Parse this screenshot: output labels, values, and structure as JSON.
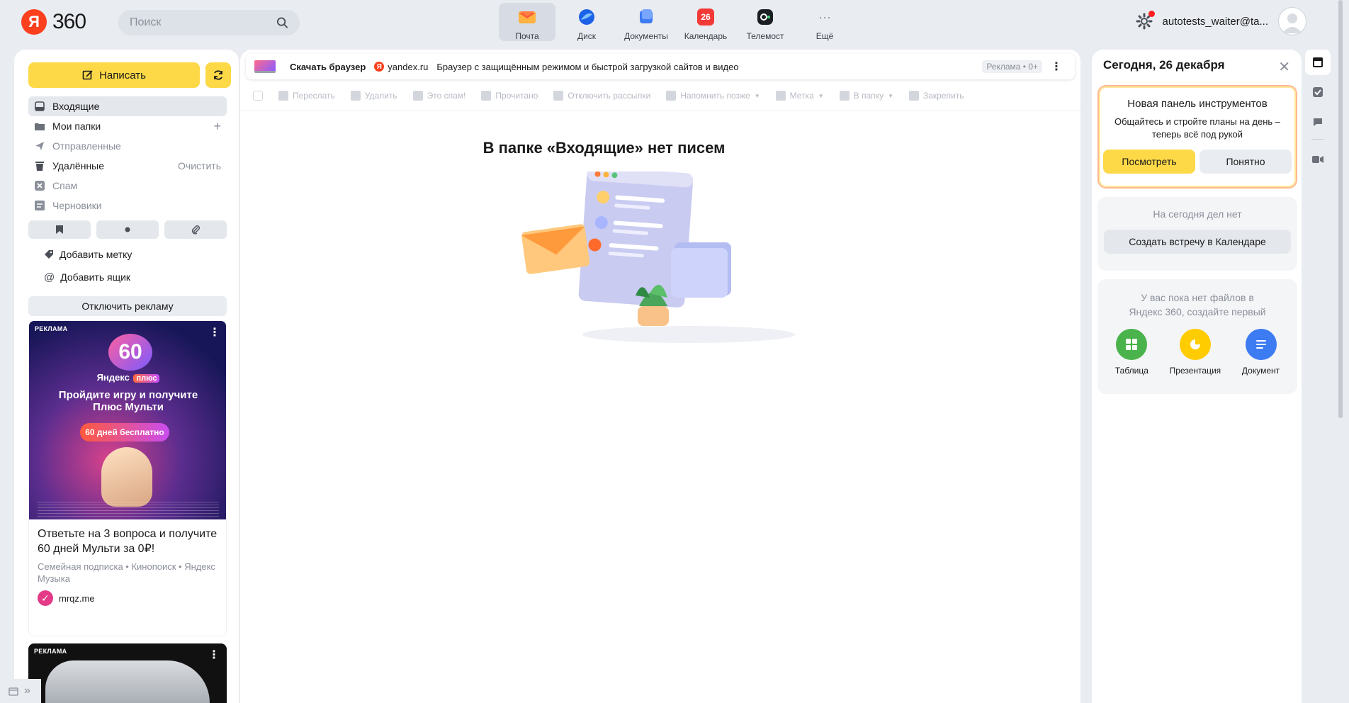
{
  "header": {
    "logo_letter": "Я",
    "logo_suffix": "360",
    "search_placeholder": "Поиск",
    "services": [
      {
        "label": "Почта",
        "icon": "mail-icon",
        "active": true
      },
      {
        "label": "Диск",
        "icon": "disk-icon"
      },
      {
        "label": "Документы",
        "icon": "documents-icon"
      },
      {
        "label": "Календарь",
        "icon": "calendar-icon",
        "badge": "26"
      },
      {
        "label": "Телемост",
        "icon": "telemost-icon"
      },
      {
        "label": "Ещё",
        "icon": "more-icon"
      }
    ],
    "user_email": "autotests_waiter@ta...",
    "colors": {
      "accent": "#fdd947",
      "brand_red": "#fc3f1d",
      "notification": "#ff1e1e"
    }
  },
  "sidebar": {
    "compose_label": "Написать",
    "folders": [
      {
        "label": "Входящие",
        "icon": "inbox-icon",
        "active": true
      },
      {
        "label": "Мои папки",
        "icon": "folder-icon",
        "action": "+"
      },
      {
        "label": "Отправленные",
        "icon": "sent-icon",
        "dim": true
      },
      {
        "label": "Удалённые",
        "icon": "trash-icon",
        "action": "Очистить"
      },
      {
        "label": "Спам",
        "icon": "spam-icon",
        "dim": true
      },
      {
        "label": "Черновики",
        "icon": "drafts-icon",
        "dim": true
      }
    ],
    "add_label": "Добавить метку",
    "add_mailbox": "Добавить ящик",
    "disable_ads": "Отключить рекламу",
    "ad1": {
      "badge": "РЕКЛАМА",
      "number": "60",
      "brand": "Яндекс",
      "brand_plus": "плюс",
      "headline": "Пройдите игру и получите Плюс Мульти",
      "pill": "60 дней бесплатно",
      "title": "Ответьте на 3 вопроса и получите 60 дней Мульти за 0₽!",
      "subtitle": "Семейная подписка • Кинопоиск • Яндекс Музыка",
      "source": "mrqz.me"
    },
    "ad2": {
      "badge": "РЕКЛАМА"
    }
  },
  "main": {
    "promo": {
      "title": "Скачать браузер",
      "domain": "yandex.ru",
      "text": "Браузер с защищённым режимом и быстрой загрузкой сайтов и видео",
      "label": "Реклама • 0+"
    },
    "toolbar": [
      "Переслать",
      "Удалить",
      "Это спам!",
      "Прочитано",
      "Отключить рассылки",
      "Напомнить позже",
      "Метка",
      "В папку",
      "Закрепить"
    ],
    "empty_title": "В папке «Входящие» нет писем"
  },
  "right_panel": {
    "date_title": "Сегодня, 26 декабря",
    "new_panel": {
      "title": "Новая панель инструментов",
      "desc": "Общайтесь и стройте планы на день – теперь всё под рукой",
      "view": "Посмотреть",
      "ok": "Понятно"
    },
    "today": {
      "empty": "На сегодня дел нет",
      "create": "Создать встречу в Календаре"
    },
    "files": {
      "empty": "У вас пока нет файлов в Яндекс 360, создайте первый",
      "tiles": [
        {
          "label": "Таблица",
          "color": "#4bb34b"
        },
        {
          "label": "Презентация",
          "color": "#ffcc00"
        },
        {
          "label": "Документ",
          "color": "#3d7bf2"
        }
      ]
    }
  }
}
